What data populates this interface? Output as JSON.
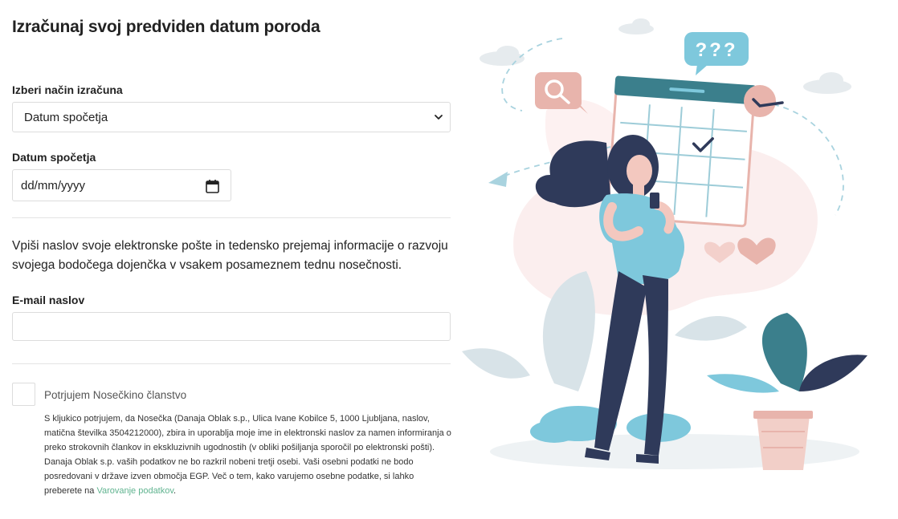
{
  "page": {
    "title": "Izračunaj svoj predviden datum poroda"
  },
  "calc": {
    "method_label": "Izberi način izračuna",
    "method_selected": "Datum spočetja",
    "date_label": "Datum spočetja",
    "date_placeholder": "dd/mm/yyyy"
  },
  "newsletter": {
    "intro": "Vpiši naslov svoje elektronske pošte in tedensko prejemaj informacije o razvoju svojega bodočega dojenčka v vsakem posameznem tednu nosečnosti.",
    "email_label": "E-mail naslov",
    "email_value": ""
  },
  "consent": {
    "checkbox_label": "Potrjujem Nosečkino članstvo",
    "legal_text": "S kljukico potrjujem, da Nosečka (Danaja Oblak s.p., Ulica Ivane Kobilce 5, 1000 Ljubljana, naslov, matična številka 3504212000), zbira in uporablja moje ime in elektronski naslov za namen informiranja o preko strokovnih člankov in ekskluzivnih ugodnostih (v obliki pošiljanja sporočil po elektronski pošti). Danaja Oblak s.p. vaših podatkov ne bo razkril nobeni tretji osebi. Vaši osebni podatki ne bodo posredovani v države izven območja EGP. Več o tem, kako varujemo osebne podatke, si lahko preberete na ",
    "privacy_link": "Varovanje podatkov",
    "legal_end": "."
  },
  "illustration": {
    "bubble_text": "???"
  },
  "colors": {
    "accent": "#5fb38f",
    "teal": "#3b7f8c",
    "light_blue": "#7ec8dc",
    "navy": "#2f3a5a",
    "pink": "#e8b4ac"
  },
  "icons": {
    "select_arrow": "chevron-down-icon",
    "date_picker": "calendar-icon"
  }
}
